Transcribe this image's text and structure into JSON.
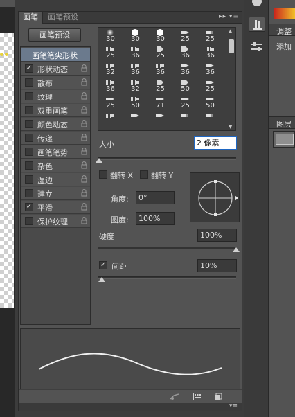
{
  "tabs": [
    {
      "label": "画笔",
      "active": true
    },
    {
      "label": "画笔预设",
      "active": false
    }
  ],
  "panel_menu_glyph": "▸▸ ▾≡",
  "preset_button_label": "画笔预设",
  "settings": [
    {
      "label": "画笔笔尖形状",
      "checked": null,
      "lock": false,
      "selected": true
    },
    {
      "label": "形状动态",
      "checked": true,
      "lock": true
    },
    {
      "label": "散布",
      "checked": false,
      "lock": true
    },
    {
      "label": "纹理",
      "checked": false,
      "lock": true
    },
    {
      "label": "双重画笔",
      "checked": false,
      "lock": true
    },
    {
      "label": "颜色动态",
      "checked": false,
      "lock": true
    },
    {
      "label": "传递",
      "checked": false,
      "lock": true
    },
    {
      "label": "画笔笔势",
      "checked": false,
      "lock": true
    },
    {
      "label": "杂色",
      "checked": false,
      "lock": true
    },
    {
      "label": "湿边",
      "checked": false,
      "lock": true
    },
    {
      "label": "建立",
      "checked": false,
      "lock": true
    },
    {
      "label": "平滑",
      "checked": true,
      "lock": true
    },
    {
      "label": "保护纹理",
      "checked": false,
      "lock": true
    }
  ],
  "brush_tips": [
    {
      "size": "30",
      "shape": "soft-round"
    },
    {
      "size": "30",
      "shape": "hard-round"
    },
    {
      "size": "30",
      "shape": "hard-round"
    },
    {
      "size": "25",
      "shape": "arrow-tip"
    },
    {
      "size": "25",
      "shape": "square-tip"
    },
    {
      "size": "25",
      "shape": "bristle"
    },
    {
      "size": "36",
      "shape": "bristle"
    },
    {
      "size": "25",
      "shape": "chisel"
    },
    {
      "size": "36",
      "shape": "chisel"
    },
    {
      "size": "36",
      "shape": "bristle"
    },
    {
      "size": "32",
      "shape": "bristle"
    },
    {
      "size": "36",
      "shape": "bristle"
    },
    {
      "size": "36",
      "shape": "bristle"
    },
    {
      "size": "36",
      "shape": "arrow-tip"
    },
    {
      "size": "36",
      "shape": "arrow-tip"
    },
    {
      "size": "36",
      "shape": "bristle"
    },
    {
      "size": "32",
      "shape": "bristle"
    },
    {
      "size": "25",
      "shape": "chisel"
    },
    {
      "size": "50",
      "shape": "chisel"
    },
    {
      "size": "25",
      "shape": "arrow-tip"
    },
    {
      "size": "25",
      "shape": "arrow-tip"
    },
    {
      "size": "50",
      "shape": "bristle"
    },
    {
      "size": "71",
      "shape": "arrow-tip"
    },
    {
      "size": "25",
      "shape": "arrow-tip"
    },
    {
      "size": "50",
      "shape": "arrow-tip"
    },
    {
      "size": "",
      "shape": "bristle"
    },
    {
      "size": "",
      "shape": "arrow-tip"
    },
    {
      "size": "",
      "shape": "arrow-tip"
    },
    {
      "size": "",
      "shape": "square-tip"
    },
    {
      "size": "",
      "shape": "square-tip"
    }
  ],
  "size": {
    "label": "大小",
    "value": "2 像素",
    "fraction": 0.01
  },
  "flip_x": {
    "label": "翻转 X",
    "checked": false
  },
  "flip_y": {
    "label": "翻转 Y",
    "checked": false
  },
  "angle": {
    "label": "角度:",
    "value": "0°"
  },
  "roundness": {
    "label": "圆度:",
    "value": "100%"
  },
  "hardness": {
    "label": "硬度",
    "value": "100%",
    "fraction": 1.0
  },
  "spacing": {
    "label": "间距",
    "checked": true,
    "value": "10%",
    "fraction": 0.03
  },
  "right_panel": {
    "adjust_label": "调整",
    "add_label": "添加",
    "layers_label": "图层"
  },
  "colors": {
    "panel": "#535353",
    "selected_row": "#6b7a8d",
    "accent_input_border": "#1e66c2"
  }
}
